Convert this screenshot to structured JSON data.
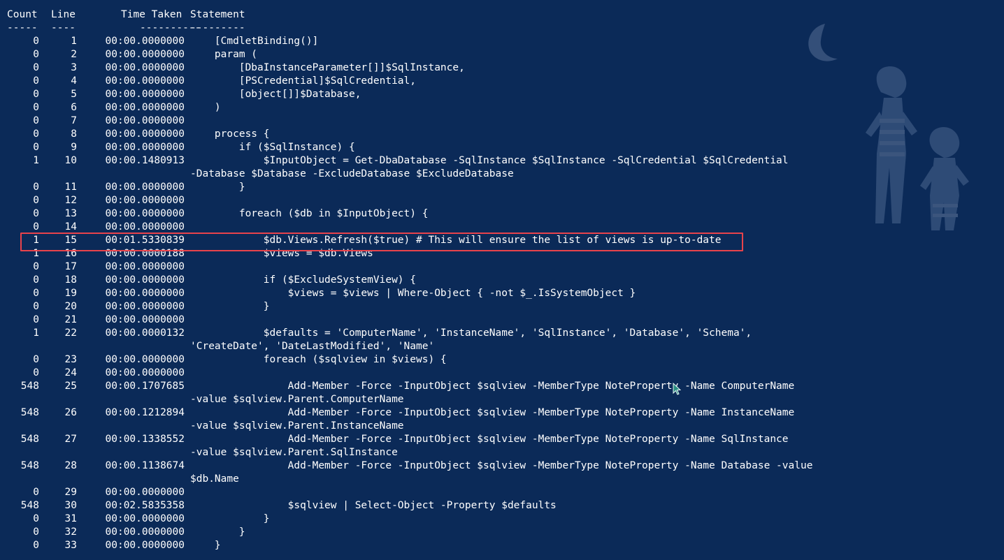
{
  "header": {
    "count": "Count",
    "line": "Line",
    "time": "Time Taken",
    "statement": "Statement"
  },
  "dashes": {
    "count": "-----",
    "line": "----",
    "time": "----------",
    "statement": "---------"
  },
  "rows": [
    {
      "count": "0",
      "line": "1",
      "time": "00:00.0000000",
      "statement": "    [CmdletBinding()]"
    },
    {
      "count": "0",
      "line": "2",
      "time": "00:00.0000000",
      "statement": "    param ("
    },
    {
      "count": "0",
      "line": "3",
      "time": "00:00.0000000",
      "statement": "        [DbaInstanceParameter[]]$SqlInstance,"
    },
    {
      "count": "0",
      "line": "4",
      "time": "00:00.0000000",
      "statement": "        [PSCredential]$SqlCredential,"
    },
    {
      "count": "0",
      "line": "5",
      "time": "00:00.0000000",
      "statement": "        [object[]]$Database,"
    },
    {
      "count": "0",
      "line": "6",
      "time": "00:00.0000000",
      "statement": "    )"
    },
    {
      "count": "0",
      "line": "7",
      "time": "00:00.0000000",
      "statement": ""
    },
    {
      "count": "0",
      "line": "8",
      "time": "00:00.0000000",
      "statement": "    process {"
    },
    {
      "count": "0",
      "line": "9",
      "time": "00:00.0000000",
      "statement": "        if ($SqlInstance) {"
    },
    {
      "count": "1",
      "line": "10",
      "time": "00:00.1480913",
      "statement": "            $InputObject = Get-DbaDatabase -SqlInstance $SqlInstance -SqlCredential $SqlCredential"
    },
    {
      "count": "",
      "line": "",
      "time": "",
      "statement": "-Database $Database -ExcludeDatabase $ExcludeDatabase"
    },
    {
      "count": "0",
      "line": "11",
      "time": "00:00.0000000",
      "statement": "        }"
    },
    {
      "count": "0",
      "line": "12",
      "time": "00:00.0000000",
      "statement": ""
    },
    {
      "count": "0",
      "line": "13",
      "time": "00:00.0000000",
      "statement": "        foreach ($db in $InputObject) {"
    },
    {
      "count": "0",
      "line": "14",
      "time": "00:00.0000000",
      "statement": ""
    },
    {
      "count": "1",
      "line": "15",
      "time": "00:01.5330839",
      "statement": "            $db.Views.Refresh($true) # This will ensure the list of views is up-to-date"
    },
    {
      "count": "1",
      "line": "16",
      "time": "00:00.0000188",
      "statement": "            $views = $db.Views"
    },
    {
      "count": "0",
      "line": "17",
      "time": "00:00.0000000",
      "statement": ""
    },
    {
      "count": "0",
      "line": "18",
      "time": "00:00.0000000",
      "statement": "            if ($ExcludeSystemView) {"
    },
    {
      "count": "0",
      "line": "19",
      "time": "00:00.0000000",
      "statement": "                $views = $views | Where-Object { -not $_.IsSystemObject }"
    },
    {
      "count": "0",
      "line": "20",
      "time": "00:00.0000000",
      "statement": "            }"
    },
    {
      "count": "0",
      "line": "21",
      "time": "00:00.0000000",
      "statement": ""
    },
    {
      "count": "1",
      "line": "22",
      "time": "00:00.0000132",
      "statement": "            $defaults = 'ComputerName', 'InstanceName', 'SqlInstance', 'Database', 'Schema',"
    },
    {
      "count": "",
      "line": "",
      "time": "",
      "statement": "'CreateDate', 'DateLastModified', 'Name'"
    },
    {
      "count": "0",
      "line": "23",
      "time": "00:00.0000000",
      "statement": "            foreach ($sqlview in $views) {"
    },
    {
      "count": "0",
      "line": "24",
      "time": "00:00.0000000",
      "statement": ""
    },
    {
      "count": "548",
      "line": "25",
      "time": "00:00.1707685",
      "statement": "                Add-Member -Force -InputObject $sqlview -MemberType NoteProperty -Name ComputerName"
    },
    {
      "count": "",
      "line": "",
      "time": "",
      "statement": "-value $sqlview.Parent.ComputerName"
    },
    {
      "count": "548",
      "line": "26",
      "time": "00:00.1212894",
      "statement": "                Add-Member -Force -InputObject $sqlview -MemberType NoteProperty -Name InstanceName"
    },
    {
      "count": "",
      "line": "",
      "time": "",
      "statement": "-value $sqlview.Parent.InstanceName"
    },
    {
      "count": "548",
      "line": "27",
      "time": "00:00.1338552",
      "statement": "                Add-Member -Force -InputObject $sqlview -MemberType NoteProperty -Name SqlInstance"
    },
    {
      "count": "",
      "line": "",
      "time": "",
      "statement": "-value $sqlview.Parent.SqlInstance"
    },
    {
      "count": "548",
      "line": "28",
      "time": "00:00.1138674",
      "statement": "                Add-Member -Force -InputObject $sqlview -MemberType NoteProperty -Name Database -value"
    },
    {
      "count": "",
      "line": "",
      "time": "",
      "statement": "$db.Name"
    },
    {
      "count": "0",
      "line": "29",
      "time": "00:00.0000000",
      "statement": ""
    },
    {
      "count": "548",
      "line": "30",
      "time": "00:02.5835358",
      "statement": "                $sqlview | Select-Object -Property $defaults"
    },
    {
      "count": "0",
      "line": "31",
      "time": "00:00.0000000",
      "statement": "            }"
    },
    {
      "count": "0",
      "line": "32",
      "time": "00:00.0000000",
      "statement": "        }"
    },
    {
      "count": "0",
      "line": "33",
      "time": "00:00.0000000",
      "statement": "    }"
    }
  ],
  "highlighted_line": "15",
  "colors": {
    "background": "#0b2a58",
    "text": "#ffffff",
    "highlight_border": "#e8434b"
  },
  "icons": {
    "wallpaper": "moon-and-cartoon-figures-wallpaper",
    "cursor": "mouse-pointer-icon"
  }
}
